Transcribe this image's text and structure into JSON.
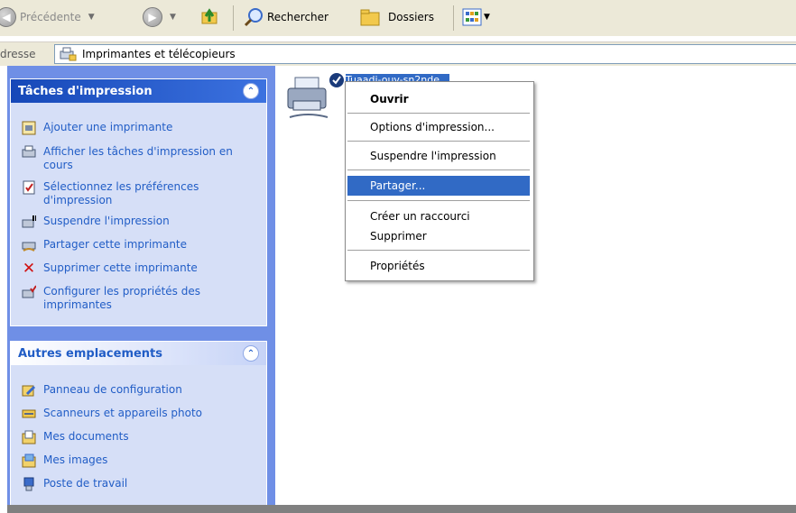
{
  "toolbar": {
    "back_label": "Précédente",
    "search_label": "Rechercher",
    "folders_label": "Dossiers"
  },
  "address": {
    "label": "dresse",
    "value": "Imprimantes et télécopieurs"
  },
  "left_pane": {
    "print_tasks": {
      "title": "Tâches d'impression",
      "items": [
        {
          "icon": "add-printer-icon",
          "label": "Ajouter une imprimante"
        },
        {
          "icon": "print-queue-icon",
          "label": "Afficher les tâches d'impression en cours"
        },
        {
          "icon": "preferences-icon",
          "label": "Sélectionnez les préférences d'impression"
        },
        {
          "icon": "pause-printer-icon",
          "label": "Suspendre l'impression"
        },
        {
          "icon": "share-printer-icon",
          "label": "Partager cette imprimante"
        },
        {
          "icon": "delete-icon",
          "label": "Supprimer cette imprimante"
        },
        {
          "icon": "printer-properties-icon",
          "label": "Configurer les propriétés des imprimantes"
        }
      ]
    },
    "other_places": {
      "title": "Autres emplacements",
      "items": [
        {
          "icon": "control-panel-icon",
          "label": "Panneau de configuration"
        },
        {
          "icon": "scanner-icon",
          "label": "Scanneurs et appareils photo"
        },
        {
          "icon": "my-documents-icon",
          "label": "Mes documents"
        },
        {
          "icon": "my-pictures-icon",
          "label": "Mes images"
        },
        {
          "icon": "my-computer-icon",
          "label": "Poste de travail"
        }
      ]
    }
  },
  "printer": {
    "label": "Tuaadi-ouv-sn2nde",
    "status": "default"
  },
  "context_menu": {
    "items": [
      {
        "label": "Ouvrir",
        "bold": true
      },
      {
        "label": "Options d'impression..."
      },
      {
        "label": "Suspendre l'impression"
      },
      {
        "label": "Partager...",
        "highlighted": true
      },
      {
        "label": "Créer un raccourci"
      },
      {
        "label": "Supprimer"
      },
      {
        "label": "Propriétés"
      }
    ]
  },
  "colors": {
    "task_link": "#215dc6",
    "selection": "#316ac5",
    "pane_bg": "#6f8fe6"
  }
}
